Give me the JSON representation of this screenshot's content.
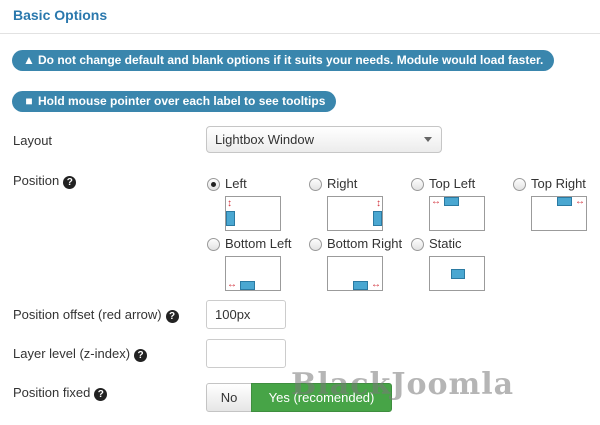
{
  "section": {
    "title": "Basic Options"
  },
  "notices": [
    {
      "icon": "warning-icon",
      "text": "Do not change default and blank options if it suits your needs. Module would load faster."
    },
    {
      "icon": "comment-icon",
      "text": "Hold mouse pointer over each label to see tooltips"
    }
  ],
  "layout": {
    "label": "Layout",
    "selected": "Lightbox Window"
  },
  "position": {
    "label": "Position",
    "selected": "Left",
    "options": [
      "Left",
      "Right",
      "Top Left",
      "Top Right",
      "Bottom Left",
      "Bottom Right",
      "Static"
    ]
  },
  "offset": {
    "label": "Position offset (red arrow)",
    "value": "100px"
  },
  "zindex": {
    "label": "Layer level (z-index)",
    "value": ""
  },
  "fixed": {
    "label": "Position fixed",
    "no_label": "No",
    "yes_label": "Yes (recomended)",
    "selected": "Yes (recomended)"
  },
  "watermark": "BlackJoomla",
  "colors": {
    "accent": "#2a78ad",
    "pill": "#3a86ad",
    "success": "#47a447",
    "arrow": "#d3313b",
    "block": "#4aa7d1"
  }
}
